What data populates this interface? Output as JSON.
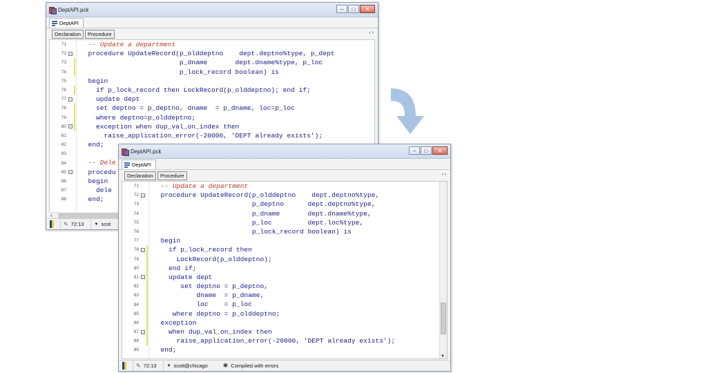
{
  "back_window": {
    "title": "DeptAPI.pck",
    "tab": "DeptAPI",
    "toolbar": [
      "Declaration",
      "Procedure"
    ],
    "scroll_arrows": "‹ ›",
    "status": {
      "position": "72:13",
      "connection": "scot"
    },
    "lines": [
      {
        "n": "71",
        "fold": "",
        "mark": false,
        "text": "  -- Update a department",
        "type": "comment"
      },
      {
        "n": "72",
        "fold": "⊟",
        "mark": false,
        "text": "  procedure UpdateRecord(p_olddeptno    dept.deptno%type, p_dept",
        "type": "code"
      },
      {
        "n": "73",
        "fold": "",
        "mark": true,
        "text": "                         p_dname       dept.dname%type, p_loc",
        "type": "code"
      },
      {
        "n": "74",
        "fold": "",
        "mark": true,
        "text": "                         p_lock_record boolean) is",
        "type": "code"
      },
      {
        "n": "75",
        "fold": "",
        "mark": false,
        "text": "  begin",
        "type": "code"
      },
      {
        "n": "76",
        "fold": "",
        "mark": true,
        "text": "    if p_lock_record then LockRecord(p_olddeptno); end if;",
        "type": "code"
      },
      {
        "n": "77",
        "fold": "⊟",
        "mark": false,
        "text": "    update dept",
        "type": "code"
      },
      {
        "n": "78",
        "fold": "",
        "mark": true,
        "text": "    set deptno = p_deptno, dname  = p_dname, loc=p_loc",
        "type": "code"
      },
      {
        "n": "79",
        "fold": "",
        "mark": true,
        "text": "    where deptno=p_olddeptno;",
        "type": "code"
      },
      {
        "n": "80",
        "fold": "⊟",
        "mark": true,
        "text": "    exception when dup_val_on_index then",
        "type": "code"
      },
      {
        "n": "81",
        "fold": "",
        "mark": false,
        "text": "      raise_application_error(-20000, 'DEPT already exists');",
        "type": "code"
      },
      {
        "n": "82",
        "fold": "",
        "mark": false,
        "text": "  end;",
        "type": "code"
      },
      {
        "n": "83",
        "fold": "",
        "mark": false,
        "text": "",
        "type": "code"
      },
      {
        "n": "84",
        "fold": "",
        "mark": false,
        "text": "  -- Dele",
        "type": "comment"
      },
      {
        "n": "85",
        "fold": "⊟",
        "mark": false,
        "text": "  procedu",
        "type": "code"
      },
      {
        "n": "86",
        "fold": "",
        "mark": false,
        "text": "  begin",
        "type": "code"
      },
      {
        "n": "87",
        "fold": "",
        "mark": false,
        "text": "    dele",
        "type": "code"
      },
      {
        "n": "88",
        "fold": "",
        "mark": false,
        "text": "  end;",
        "type": "code"
      }
    ]
  },
  "front_window": {
    "title": "DeptAPI.pck",
    "tab": "DeptAPI",
    "toolbar": [
      "Declaration",
      "Procedure"
    ],
    "scroll_arrows": "‹ ›",
    "status": {
      "position": "72:13",
      "connection": "scott@chicago",
      "message": "Compiled with errors"
    },
    "lines": [
      {
        "n": "71",
        "fold": "",
        "mark": false,
        "text": "  -- Update a department",
        "type": "comment"
      },
      {
        "n": "72",
        "fold": "⊟",
        "mark": false,
        "text": "  procedure UpdateRecord(p_olddeptno    dept.deptno%type,",
        "type": "code"
      },
      {
        "n": "73",
        "fold": "",
        "mark": false,
        "text": "                         p_deptno      dept.deptno%type,",
        "type": "code"
      },
      {
        "n": "74",
        "fold": "",
        "mark": false,
        "text": "                         p_dname       dept.dname%type,",
        "type": "code"
      },
      {
        "n": "75",
        "fold": "",
        "mark": false,
        "text": "                         p_loc         dept.loc%type,",
        "type": "code"
      },
      {
        "n": "76",
        "fold": "",
        "mark": false,
        "text": "                         p_lock_record boolean) is",
        "type": "code"
      },
      {
        "n": "77",
        "fold": "",
        "mark": false,
        "text": "  begin",
        "type": "code"
      },
      {
        "n": "78",
        "fold": "⊟",
        "mark": true,
        "text": "    if p_lock_record then",
        "type": "code"
      },
      {
        "n": "79",
        "fold": "",
        "mark": true,
        "text": "      LockRecord(p_olddeptno);",
        "type": "code"
      },
      {
        "n": "80",
        "fold": "",
        "mark": true,
        "text": "    end if;",
        "type": "code"
      },
      {
        "n": "81",
        "fold": "⊟",
        "mark": true,
        "text": "    update dept",
        "type": "code"
      },
      {
        "n": "82",
        "fold": "",
        "mark": true,
        "text": "       set deptno = p_deptno,",
        "type": "code"
      },
      {
        "n": "83",
        "fold": "",
        "mark": true,
        "text": "           dname  = p_dname,",
        "type": "code"
      },
      {
        "n": "84",
        "fold": "",
        "mark": true,
        "text": "           loc    = p_loc",
        "type": "code"
      },
      {
        "n": "85",
        "fold": "",
        "mark": true,
        "text": "     where deptno = p_olddeptno;",
        "type": "code"
      },
      {
        "n": "86",
        "fold": "",
        "mark": true,
        "text": "  exception",
        "type": "code"
      },
      {
        "n": "87",
        "fold": "⊟",
        "mark": true,
        "text": "    when dup_val_on_index then",
        "type": "code"
      },
      {
        "n": "88",
        "fold": "",
        "mark": true,
        "text": "      raise_application_error(-20000, 'DEPT already exists');",
        "type": "code"
      },
      {
        "n": "89",
        "fold": "",
        "mark": false,
        "text": "  end;",
        "type": "code"
      }
    ]
  },
  "icons": {
    "doc": "document-icon",
    "tab": "package-icon",
    "arrow": "curved-arrow-down-icon",
    "pencil": "pencil-icon",
    "connection": "connection-dropdown-icon",
    "compile": "compile-status-icon"
  },
  "colors": {
    "arrow": "#a9c3e3",
    "keyword": "#1a1a8c",
    "comment": "#c0392b",
    "change_marker": "#e1e16a"
  }
}
